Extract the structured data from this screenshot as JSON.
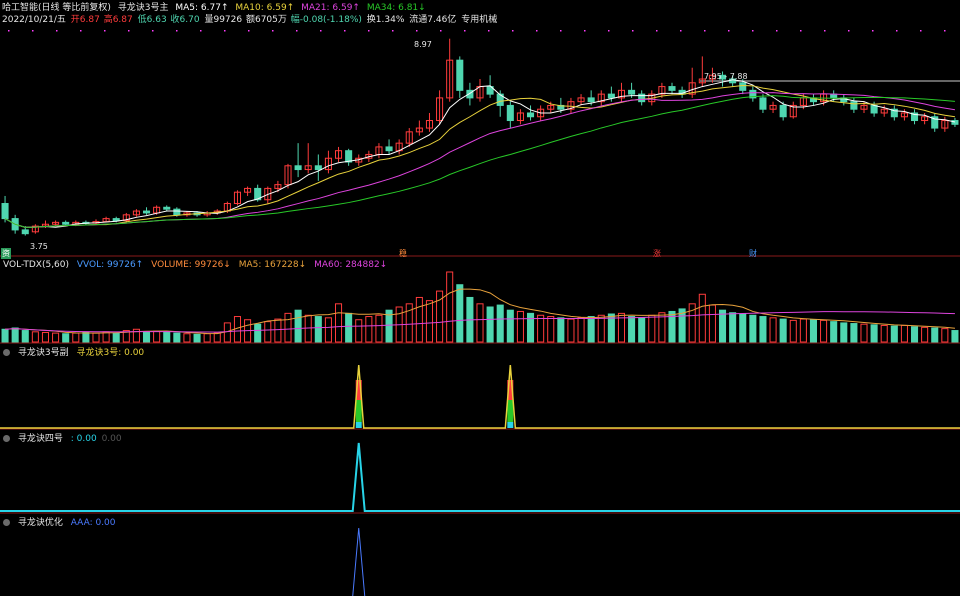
{
  "header": {
    "stock_name": "哈工智能(日线 等比前复权)",
    "indicator_name": "寻龙诀3号主",
    "ma5": "MA5: 6.77↑",
    "ma10": "MA10: 6.59↑",
    "ma21": "MA21: 6.59↑",
    "ma34": "MA34: 6.81↓",
    "date": "2022/10/21/五",
    "open": "开6.87",
    "high": "高6.87",
    "low": "低6.63",
    "close": "收6.70",
    "volume": "量99726",
    "amount": "额6705万",
    "change": "幅-0.08(-1.18%)",
    "turnover": "换1.34%",
    "float_cap": "流通7.46亿",
    "concept": "专用机械"
  },
  "price_panel": {
    "high_label": "8.97",
    "low_label": "3.75",
    "range_label": "7.95 - 7.88",
    "markers": [
      "资",
      "稳",
      "涨",
      "财"
    ]
  },
  "volume_panel": {
    "name": "VOL-TDX(5,60)",
    "vvol": "VVOL: 99726↑",
    "volume": "VOLUME: 99726↓",
    "ma5": "MA5: 167228↓",
    "ma60": "MA60: 284882↓"
  },
  "panel3": {
    "name": "寻龙诀3号副",
    "value": "寻龙诀3号: 0.00"
  },
  "panel4": {
    "name": "寻龙诀四号",
    "value": ": 0.00",
    "value2": "0.00"
  },
  "panel5": {
    "name": "寻龙诀优化",
    "value": "AAA: 0.00"
  },
  "colors": {
    "up": "#ff3c3c",
    "down": "#4fd6b0",
    "ma5": "#ffffff",
    "ma10": "#e8d23c",
    "ma21": "#dd44dd",
    "ma34": "#28c828"
  },
  "chart_data": {
    "type": "candlestick",
    "ylim": [
      3.5,
      9.2
    ],
    "candles": [
      [
        4.6,
        4.2,
        4.8,
        4.1
      ],
      [
        4.2,
        3.9,
        4.3,
        3.8
      ],
      [
        3.9,
        3.8,
        4.0,
        3.75
      ],
      [
        3.85,
        4.0,
        4.05,
        3.8
      ],
      [
        4.0,
        4.05,
        4.15,
        3.95
      ],
      [
        4.05,
        4.1,
        4.15,
        4.0
      ],
      [
        4.1,
        4.05,
        4.15,
        4.0
      ],
      [
        4.05,
        4.1,
        4.15,
        4.0
      ],
      [
        4.1,
        4.08,
        4.15,
        4.02
      ],
      [
        4.08,
        4.12,
        4.18,
        4.05
      ],
      [
        4.12,
        4.2,
        4.25,
        4.1
      ],
      [
        4.2,
        4.15,
        4.25,
        4.1
      ],
      [
        4.15,
        4.3,
        4.35,
        4.1
      ],
      [
        4.3,
        4.4,
        4.45,
        4.25
      ],
      [
        4.4,
        4.35,
        4.5,
        4.3
      ],
      [
        4.35,
        4.5,
        4.55,
        4.3
      ],
      [
        4.5,
        4.45,
        4.55,
        4.4
      ],
      [
        4.45,
        4.3,
        4.5,
        4.25
      ],
      [
        4.3,
        4.35,
        4.4,
        4.25
      ],
      [
        4.35,
        4.3,
        4.4,
        4.25
      ],
      [
        4.3,
        4.35,
        4.4,
        4.25
      ],
      [
        4.35,
        4.4,
        4.45,
        4.3
      ],
      [
        4.4,
        4.6,
        4.65,
        4.35
      ],
      [
        4.6,
        4.9,
        4.95,
        4.55
      ],
      [
        4.9,
        5.0,
        5.05,
        4.8
      ],
      [
        5.0,
        4.7,
        5.1,
        4.65
      ],
      [
        4.7,
        5.0,
        5.05,
        4.6
      ],
      [
        5.0,
        5.1,
        5.2,
        4.9
      ],
      [
        5.1,
        5.6,
        5.65,
        5.0
      ],
      [
        5.6,
        5.5,
        6.2,
        5.3
      ],
      [
        5.5,
        5.6,
        6.2,
        5.4
      ],
      [
        5.6,
        5.5,
        5.9,
        5.2
      ],
      [
        5.5,
        5.8,
        6.0,
        5.4
      ],
      [
        5.8,
        6.0,
        6.1,
        5.7
      ],
      [
        6.0,
        5.7,
        6.05,
        5.6
      ],
      [
        5.7,
        5.8,
        5.9,
        5.6
      ],
      [
        5.8,
        5.9,
        6.0,
        5.7
      ],
      [
        5.9,
        6.1,
        6.2,
        5.8
      ],
      [
        6.1,
        6.0,
        6.3,
        5.9
      ],
      [
        6.0,
        6.2,
        6.3,
        5.9
      ],
      [
        6.2,
        6.5,
        6.6,
        6.1
      ],
      [
        6.5,
        6.6,
        6.8,
        6.4
      ],
      [
        6.6,
        6.8,
        7.0,
        6.5
      ],
      [
        6.8,
        7.4,
        7.6,
        6.7
      ],
      [
        7.4,
        8.4,
        8.97,
        7.3
      ],
      [
        8.4,
        7.6,
        8.5,
        7.4
      ],
      [
        7.6,
        7.4,
        7.8,
        7.2
      ],
      [
        7.4,
        7.7,
        7.9,
        7.3
      ],
      [
        7.7,
        7.5,
        8.0,
        7.4
      ],
      [
        7.5,
        7.2,
        7.6,
        6.9
      ],
      [
        7.2,
        6.8,
        7.3,
        6.6
      ],
      [
        6.8,
        7.0,
        7.1,
        6.7
      ],
      [
        7.0,
        6.9,
        7.2,
        6.8
      ],
      [
        6.9,
        7.1,
        7.2,
        6.8
      ],
      [
        7.1,
        7.2,
        7.3,
        7.0
      ],
      [
        7.2,
        7.1,
        7.4,
        7.0
      ],
      [
        7.1,
        7.3,
        7.4,
        7.0
      ],
      [
        7.3,
        7.4,
        7.5,
        7.2
      ],
      [
        7.4,
        7.3,
        7.6,
        7.2
      ],
      [
        7.3,
        7.5,
        7.6,
        7.2
      ],
      [
        7.5,
        7.4,
        7.7,
        7.3
      ],
      [
        7.4,
        7.6,
        7.8,
        7.3
      ],
      [
        7.6,
        7.5,
        7.8,
        7.4
      ],
      [
        7.5,
        7.3,
        7.6,
        7.2
      ],
      [
        7.3,
        7.5,
        7.6,
        7.2
      ],
      [
        7.5,
        7.7,
        7.8,
        7.4
      ],
      [
        7.7,
        7.6,
        7.8,
        7.5
      ],
      [
        7.6,
        7.5,
        7.7,
        7.4
      ],
      [
        7.5,
        7.8,
        8.2,
        7.4
      ],
      [
        7.8,
        7.9,
        8.5,
        7.7
      ],
      [
        7.9,
        8.0,
        8.2,
        7.8
      ],
      [
        8.0,
        7.9,
        8.1,
        7.7
      ],
      [
        7.9,
        7.8,
        8.0,
        7.7
      ],
      [
        7.8,
        7.6,
        7.9,
        7.5
      ],
      [
        7.6,
        7.4,
        7.7,
        7.3
      ],
      [
        7.4,
        7.1,
        7.5,
        7.0
      ],
      [
        7.1,
        7.2,
        7.3,
        7.0
      ],
      [
        7.2,
        6.9,
        7.3,
        6.8
      ],
      [
        6.9,
        7.2,
        7.3,
        6.85
      ],
      [
        7.2,
        7.4,
        7.5,
        7.1
      ],
      [
        7.4,
        7.3,
        7.5,
        7.2
      ],
      [
        7.3,
        7.5,
        7.6,
        7.2
      ],
      [
        7.5,
        7.4,
        7.6,
        7.3
      ],
      [
        7.4,
        7.3,
        7.5,
        7.2
      ],
      [
        7.3,
        7.1,
        7.4,
        7.0
      ],
      [
        7.1,
        7.2,
        7.3,
        7.0
      ],
      [
        7.2,
        7.0,
        7.3,
        6.9
      ],
      [
        7.0,
        7.1,
        7.2,
        6.9
      ],
      [
        7.1,
        6.9,
        7.2,
        6.8
      ],
      [
        6.9,
        7.0,
        7.1,
        6.8
      ],
      [
        7.0,
        6.8,
        7.1,
        6.7
      ],
      [
        6.8,
        6.9,
        7.0,
        6.7
      ],
      [
        6.9,
        6.6,
        7.0,
        6.5
      ],
      [
        6.6,
        6.8,
        6.9,
        6.5
      ],
      [
        6.8,
        6.7,
        6.87,
        6.63
      ]
    ],
    "volume": [
      20,
      22,
      18,
      16,
      15,
      14,
      13,
      14,
      15,
      14,
      16,
      14,
      18,
      20,
      16,
      17,
      15,
      14,
      13,
      12,
      13,
      14,
      30,
      40,
      35,
      28,
      32,
      36,
      45,
      50,
      42,
      40,
      38,
      60,
      45,
      35,
      40,
      42,
      50,
      55,
      60,
      70,
      65,
      80,
      110,
      90,
      70,
      60,
      55,
      58,
      50,
      48,
      45,
      42,
      40,
      38,
      36,
      38,
      40,
      42,
      44,
      45,
      40,
      38,
      42,
      46,
      48,
      52,
      60,
      75,
      58,
      50,
      46,
      44,
      42,
      40,
      38,
      36,
      34,
      36,
      35,
      34,
      32,
      30,
      29,
      28,
      27,
      26,
      25,
      26,
      24,
      23,
      22,
      21,
      18
    ],
    "signals3": [
      35,
      50
    ],
    "signal4": 35,
    "signal5": 35
  }
}
